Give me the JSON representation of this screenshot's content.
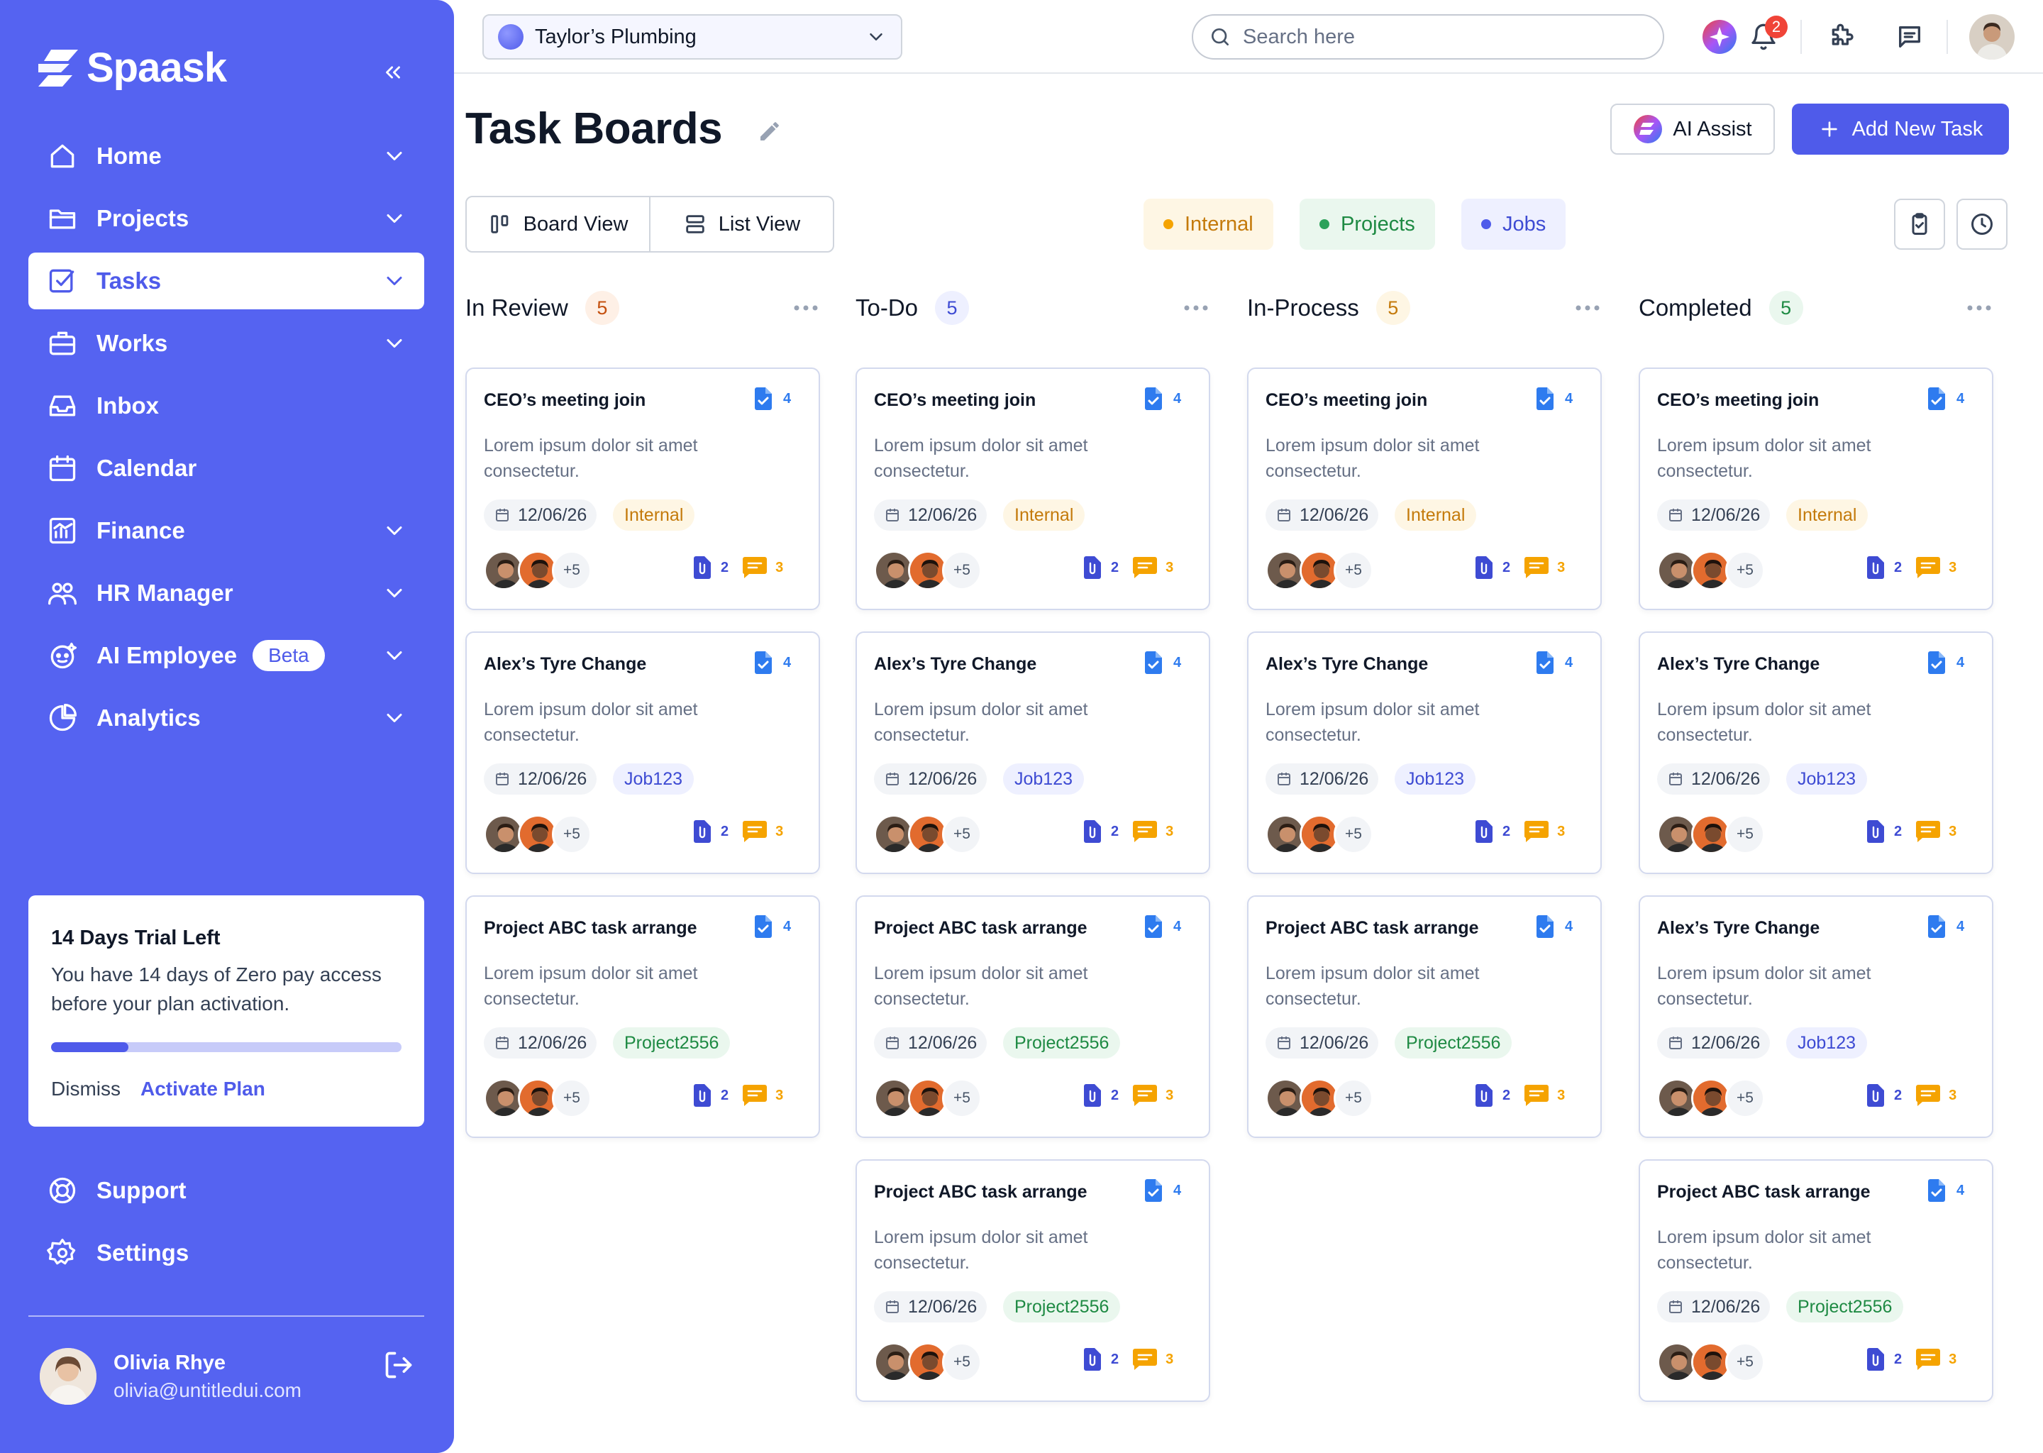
{
  "brand": {
    "name": "Spaask"
  },
  "sidebar": {
    "items": [
      {
        "label": "Home",
        "icon": "home-icon",
        "has_chevron": true,
        "active": false
      },
      {
        "label": "Projects",
        "icon": "folder-icon",
        "has_chevron": true,
        "active": false
      },
      {
        "label": "Tasks",
        "icon": "checkbox-icon",
        "has_chevron": true,
        "active": true
      },
      {
        "label": "Works",
        "icon": "briefcase-icon",
        "has_chevron": true,
        "active": false
      },
      {
        "label": "Inbox",
        "icon": "inbox-icon",
        "has_chevron": false,
        "active": false
      },
      {
        "label": "Calendar",
        "icon": "calendar-icon",
        "has_chevron": false,
        "active": false
      },
      {
        "label": "Finance",
        "icon": "chart-icon",
        "has_chevron": true,
        "active": false
      },
      {
        "label": "HR Manager",
        "icon": "users-icon",
        "has_chevron": true,
        "active": false
      },
      {
        "label": "AI Employee",
        "icon": "robot-icon",
        "has_chevron": true,
        "active": false,
        "badge": "Beta"
      },
      {
        "label": "Analytics",
        "icon": "pie-icon",
        "has_chevron": true,
        "active": false
      }
    ],
    "bottom_items": [
      {
        "label": "Support",
        "icon": "lifebuoy-icon"
      },
      {
        "label": "Settings",
        "icon": "gear-icon"
      }
    ],
    "trial": {
      "title": "14 Days Trial Left",
      "text": "You have 14 days of Zero pay access before your plan activation.",
      "progress": 0.22,
      "dismiss_label": "Dismiss",
      "activate_label": "Activate Plan"
    },
    "user": {
      "name": "Olivia Rhye",
      "email": "olivia@untitledui.com"
    }
  },
  "topbar": {
    "company": "Taylor’s Plumbing",
    "search_placeholder": "Search here",
    "notification_count": "2"
  },
  "page": {
    "title": "Task Boards",
    "ai_assist_label": "AI Assist",
    "add_task_label": "Add New Task",
    "views": [
      "Board View",
      "List View"
    ],
    "filters": [
      {
        "label": "Internal",
        "bg": "#FEF6E4",
        "color": "#C47A0B",
        "dot": "#F5A300"
      },
      {
        "label": "Projects",
        "bg": "#EAF7EE",
        "color": "#1E8A43",
        "dot": "#2BA159"
      },
      {
        "label": "Jobs",
        "bg": "#EEF0FF",
        "color": "#3E4BD3",
        "dot": "#4F5BEA"
      }
    ]
  },
  "colors": {
    "accent": "#4F5BEA",
    "sidebar": "#5563F1"
  },
  "columns": [
    {
      "title": "In Review",
      "count": "5",
      "count_bg": "#FEF0E6",
      "count_color": "#C4500F",
      "cards": [
        {
          "title": "CEO’s meeting join",
          "docs": "4",
          "desc": "Lorem ipsum dolor sit amet consectetur.",
          "date": "12/06/26",
          "tag": "Internal",
          "tag_type": "internal",
          "more": "+5",
          "attachments": "2",
          "comments": "3"
        },
        {
          "title": "Alex’s Tyre Change",
          "docs": "4",
          "desc": "Lorem ipsum dolor sit amet consectetur.",
          "date": "12/06/26",
          "tag": "Job123",
          "tag_type": "job",
          "more": "+5",
          "attachments": "2",
          "comments": "3"
        },
        {
          "title": "Project ABC task arrange",
          "docs": "4",
          "desc": "Lorem ipsum dolor sit amet consectetur.",
          "date": "12/06/26",
          "tag": "Project2556",
          "tag_type": "project",
          "more": "+5",
          "attachments": "2",
          "comments": "3"
        }
      ]
    },
    {
      "title": "To-Do",
      "count": "5",
      "count_bg": "#EEF0FF",
      "count_color": "#3E4BD3",
      "cards": [
        {
          "title": "CEO’s meeting join",
          "docs": "4",
          "desc": "Lorem ipsum dolor sit amet consectetur.",
          "date": "12/06/26",
          "tag": "Internal",
          "tag_type": "internal",
          "more": "+5",
          "attachments": "2",
          "comments": "3"
        },
        {
          "title": "Alex’s Tyre Change",
          "docs": "4",
          "desc": "Lorem ipsum dolor sit amet consectetur.",
          "date": "12/06/26",
          "tag": "Job123",
          "tag_type": "job",
          "more": "+5",
          "attachments": "2",
          "comments": "3"
        },
        {
          "title": "Project ABC task arrange",
          "docs": "4",
          "desc": "Lorem ipsum dolor sit amet consectetur.",
          "date": "12/06/26",
          "tag": "Project2556",
          "tag_type": "project",
          "more": "+5",
          "attachments": "2",
          "comments": "3"
        },
        {
          "title": "Project ABC task arrange",
          "docs": "4",
          "desc": "Lorem ipsum dolor sit amet consectetur.",
          "date": "12/06/26",
          "tag": "Project2556",
          "tag_type": "project",
          "more": "+5",
          "attachments": "2",
          "comments": "3"
        }
      ]
    },
    {
      "title": "In-Process",
      "count": "5",
      "count_bg": "#FEF6E4",
      "count_color": "#C47A0B",
      "cards": [
        {
          "title": "CEO’s meeting join",
          "docs": "4",
          "desc": "Lorem ipsum dolor sit amet consectetur.",
          "date": "12/06/26",
          "tag": "Internal",
          "tag_type": "internal",
          "more": "+5",
          "attachments": "2",
          "comments": "3"
        },
        {
          "title": "Alex’s Tyre Change",
          "docs": "4",
          "desc": "Lorem ipsum dolor sit amet consectetur.",
          "date": "12/06/26",
          "tag": "Job123",
          "tag_type": "job",
          "more": "+5",
          "attachments": "2",
          "comments": "3"
        },
        {
          "title": "Project ABC task arrange",
          "docs": "4",
          "desc": "Lorem ipsum dolor sit amet consectetur.",
          "date": "12/06/26",
          "tag": "Project2556",
          "tag_type": "project",
          "more": "+5",
          "attachments": "2",
          "comments": "3"
        }
      ]
    },
    {
      "title": "Completed",
      "count": "5",
      "count_bg": "#EAF7EE",
      "count_color": "#1E8A43",
      "cards": [
        {
          "title": "CEO’s meeting join",
          "docs": "4",
          "desc": "Lorem ipsum dolor sit amet consectetur.",
          "date": "12/06/26",
          "tag": "Internal",
          "tag_type": "internal",
          "more": "+5",
          "attachments": "2",
          "comments": "3"
        },
        {
          "title": "Alex’s Tyre Change",
          "docs": "4",
          "desc": "Lorem ipsum dolor sit amet consectetur.",
          "date": "12/06/26",
          "tag": "Job123",
          "tag_type": "job",
          "more": "+5",
          "attachments": "2",
          "comments": "3"
        },
        {
          "title": "Alex’s Tyre Change",
          "docs": "4",
          "desc": "Lorem ipsum dolor sit amet consectetur.",
          "date": "12/06/26",
          "tag": "Job123",
          "tag_type": "job",
          "more": "+5",
          "attachments": "2",
          "comments": "3"
        },
        {
          "title": "Project ABC task arrange",
          "docs": "4",
          "desc": "Lorem ipsum dolor sit amet consectetur.",
          "date": "12/06/26",
          "tag": "Project2556",
          "tag_type": "project",
          "more": "+5",
          "attachments": "2",
          "comments": "3"
        }
      ]
    }
  ]
}
